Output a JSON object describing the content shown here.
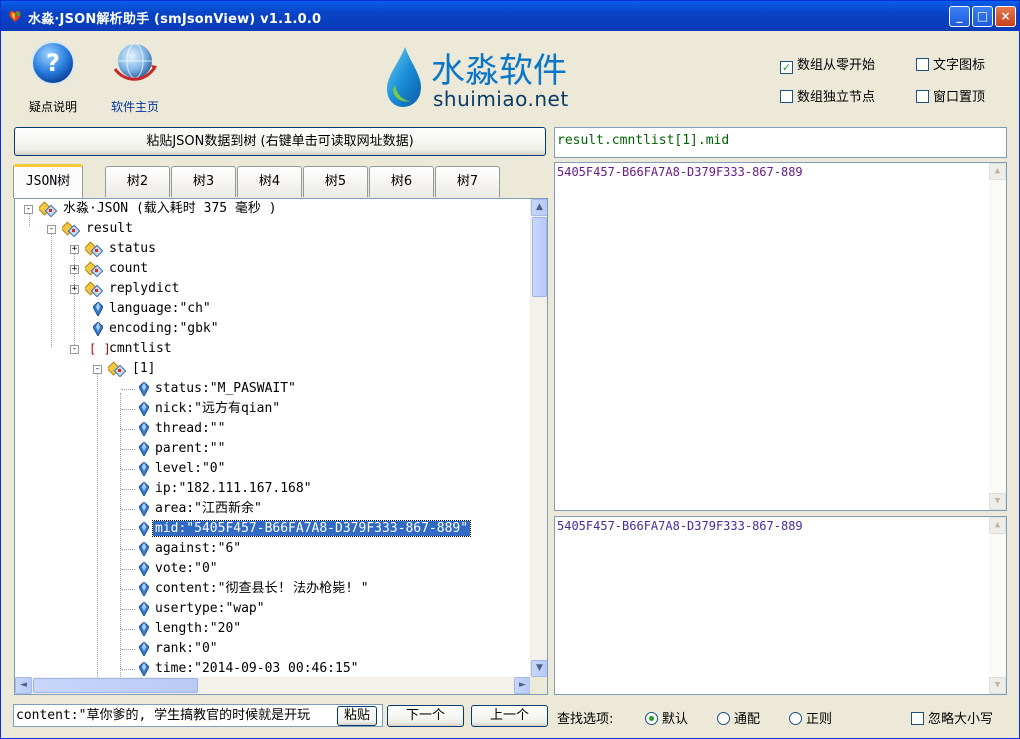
{
  "window": {
    "title": "水淼·JSON解析助手 (smJsonView) v1.1.0.0",
    "controls": {
      "minimize": "_",
      "maximize": "□",
      "close": "×"
    }
  },
  "toolbar": {
    "help_label": "疑点说明",
    "home_label": "软件主页",
    "help_icon": "question-icon",
    "home_icon": "globe-icon"
  },
  "logo": {
    "cn": "水淼软件",
    "en": "shuimiao.net"
  },
  "options": {
    "array_zero": {
      "label": "数组从零开始",
      "checked": true
    },
    "text_icon": {
      "label": "文字图标",
      "checked": false
    },
    "array_node": {
      "label": "数组独立节点",
      "checked": false
    },
    "topmost": {
      "label": "窗口置顶",
      "checked": false
    }
  },
  "paste_button": "粘贴JSON数据到树 (右键单击可读取网址数据)",
  "tabs": [
    "JSON树",
    "树2",
    "树3",
    "树4",
    "树5",
    "树6",
    "树7"
  ],
  "tree": {
    "root": "水淼·JSON (载入耗时 375 毫秒 )",
    "result": "result",
    "status": "status",
    "count": "count",
    "replydict": "replydict",
    "language": "language:\"ch\"",
    "encoding": "encoding:\"gbk\"",
    "cmntlist": "cmntlist",
    "item1": "[1]",
    "leaves": [
      "status:\"M_PASWAIT\"",
      "nick:\"远方有qian\"",
      "thread:\"\"",
      "parent:\"\"",
      "level:\"0\"",
      "ip:\"182.111.167.168\"",
      "area:\"江西新余\"",
      "mid:\"5405F457-B66FA7A8-D379F333-867-889\"",
      "against:\"6\"",
      "vote:\"0\"",
      "content:\"彻查县长! 法办枪毙! \"",
      "usertype:\"wap\"",
      "length:\"20\"",
      "rank:\"0\"",
      "time:\"2014-09-03 00:46:15\""
    ],
    "selected_index": 7
  },
  "right": {
    "path": "result.cmntlist[1].mid",
    "value_top": "5405F457-B66FA7A8-D379F333-867-889",
    "value_bottom": "5405F457-B66FA7A8-D379F333-867-889"
  },
  "bottom": {
    "search_value": "content:\"草你爹的, 学生搞教官的时候就是开玩",
    "paste_small": "粘贴",
    "next": "下一个",
    "prev": "上一个",
    "find_label": "查找选项:",
    "mode_default": "默认",
    "mode_wildcard": "通配",
    "mode_regex": "正则",
    "ignore_case": "忽略大小写",
    "selected_mode": "default"
  },
  "colors": {
    "title_bar": "#0a4fd8",
    "selection": "#316ac5",
    "path_text": "#006400",
    "value_text": "#6a1a8a",
    "tab_highlight": "#ffc83c"
  }
}
